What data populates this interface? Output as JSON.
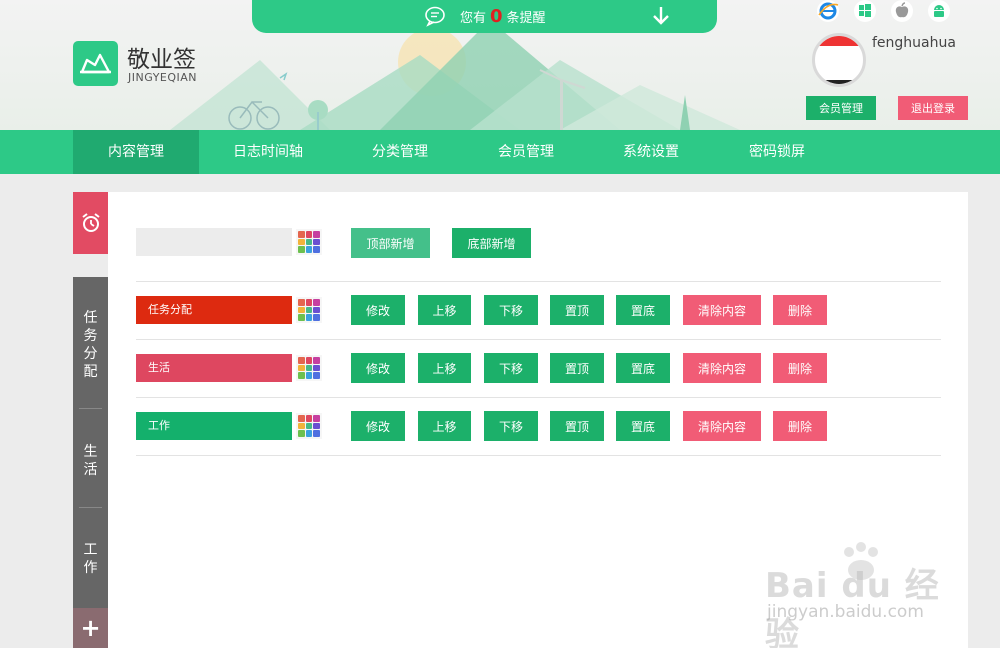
{
  "notice": {
    "prefix": "您有",
    "count": "0",
    "suffix": "条提醒"
  },
  "brand": {
    "name": "敬业签",
    "sub": "JINGYEQIAN",
    "color": "#2dc987"
  },
  "user": {
    "name": "fenghuahua",
    "member_btn": "会员管理",
    "logout_btn": "退出登录"
  },
  "platforms": [
    "ie-icon",
    "windows-icon",
    "apple-icon",
    "android-icon"
  ],
  "nav": {
    "items": [
      "内容管理",
      "日志时间轴",
      "分类管理",
      "会员管理",
      "系统设置",
      "密码锁屏"
    ],
    "active": 0
  },
  "side": {
    "items": [
      "任务分配",
      "生活",
      "工作"
    ]
  },
  "toolbar": {
    "add_top": "顶部新增",
    "add_bottom": "底部新增"
  },
  "categories": [
    {
      "name": "任务分配",
      "color": "#dd2a10"
    },
    {
      "name": "生活",
      "color": "#de4760"
    },
    {
      "name": "工作",
      "color": "#14b06c"
    }
  ],
  "row_actions": {
    "edit": "修改",
    "up": "上移",
    "down": "下移",
    "top": "置顶",
    "bottom": "置底",
    "clear": "清除内容",
    "delete": "删除"
  },
  "watermark": {
    "main": "Bai du 经验",
    "url": "jingyan.baidu.com"
  },
  "colors": {
    "green": "#2dc987",
    "button_green": "#1cb06a",
    "button_red": "#f15c76",
    "active_nav": "#20aa70"
  }
}
